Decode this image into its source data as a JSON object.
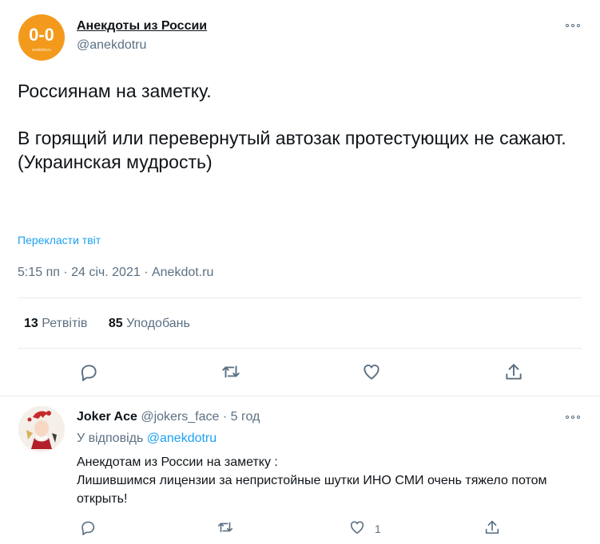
{
  "tweet": {
    "author_name": "Анекдоты из России",
    "author_handle": "@anekdotru",
    "avatar_text": "0-0",
    "avatar_subtext": "anekdot.ru",
    "text": "Россиянам на заметку.\n\nВ горящий или перевернутый автозак протестующих не сажают.\n(Украинская мудрость)",
    "translate_label": "Перекласти твіт",
    "meta": "5:15 пп · 24 січ. 2021 · Anekdot.ru",
    "retweets_count": "13",
    "retweets_label": "Ретвітів",
    "likes_count": "85",
    "likes_label": "Уподобань",
    "icons": [
      "reply-icon",
      "retweet-icon",
      "like-icon",
      "share-icon",
      "more-icon"
    ]
  },
  "reply": {
    "author_name": "Joker Ace",
    "author_handle": "@jokers_face",
    "separator": "·",
    "time": "5 год",
    "reply_to_prefix": "У відповідь",
    "reply_to_handle": "@anekdotru",
    "text_line1": "Анекдотам из России на заметку :",
    "text_line2": "Лишившимся лицензии за непристойные шутки ИНО СМИ очень тяжело потом открыть!",
    "like_count": "1"
  },
  "colors": {
    "accent": "#1da1f2",
    "muted": "#5b7083",
    "text": "#0f1419",
    "avatar_orange": "#f39a1d",
    "border": "#e6ecf0"
  }
}
